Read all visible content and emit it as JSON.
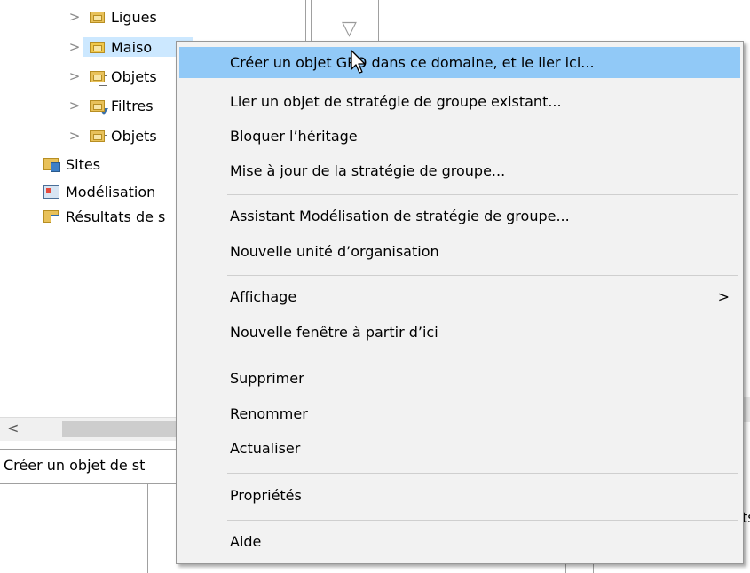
{
  "tree": {
    "items": [
      {
        "label": "Ligues",
        "icon": "folder-icon",
        "indent": 1
      },
      {
        "label": "Maiso",
        "icon": "folder-icon",
        "indent": 1,
        "selected": true
      },
      {
        "label": "Objets",
        "icon": "gpo-folder-icon",
        "indent": 1
      },
      {
        "label": "Filtres",
        "icon": "wmi-filter-icon",
        "indent": 1
      },
      {
        "label": "Objets",
        "icon": "starter-gpo-icon",
        "indent": 1
      },
      {
        "label": "Sites",
        "icon": "sites-icon",
        "indent": 0
      },
      {
        "label": "Modélisation",
        "icon": "modeling-icon",
        "indent": 0
      },
      {
        "label": "Résultats de s",
        "icon": "results-icon",
        "indent": 0
      }
    ],
    "expand_glyph": ">",
    "selection_color": "#cce8ff"
  },
  "scrollbar": {
    "left_arrow": "<"
  },
  "status_bar": {
    "text": "Créer un objet de st"
  },
  "right_pane": {
    "header_glyph": "▽",
    "fragment": "ts"
  },
  "context_menu": {
    "groups": [
      [
        {
          "label": "Créer un objet GPO dans ce domaine, et le lier ici...",
          "highlighted": true
        },
        {
          "label": "Lier un objet de stratégie de groupe existant..."
        },
        {
          "label": "Bloquer l’héritage"
        },
        {
          "label": "Mise à jour de la stratégie de groupe..."
        }
      ],
      [
        {
          "label": "Assistant Modélisation de stratégie de groupe..."
        },
        {
          "label": "Nouvelle unité d’organisation"
        }
      ],
      [
        {
          "label": "Affichage",
          "submenu": ">"
        },
        {
          "label": "Nouvelle fenêtre à partir d’ici"
        }
      ],
      [
        {
          "label": "Supprimer"
        },
        {
          "label": "Renommer"
        },
        {
          "label": "Actualiser"
        }
      ],
      [
        {
          "label": "Propriétés"
        }
      ],
      [
        {
          "label": "Aide"
        }
      ]
    ],
    "highlight_color": "#91c9f7",
    "background": "#f2f2f2"
  }
}
